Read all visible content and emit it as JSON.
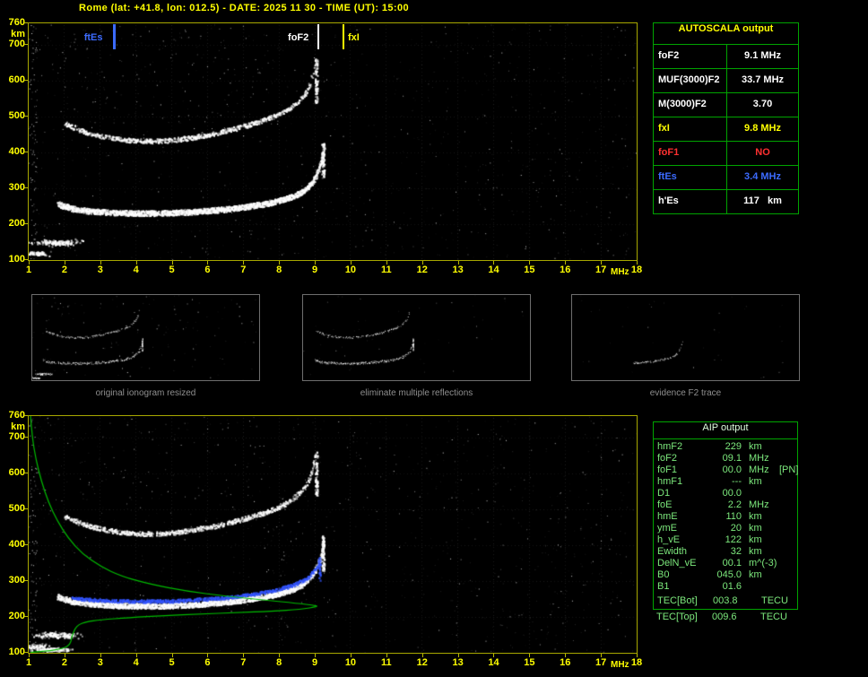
{
  "header": {
    "title": "Rome (lat: +41.8, lon: 012.5) - DATE: 2025 11 30 - TIME (UT): 15:00"
  },
  "colors": {
    "axis": "#ffff00",
    "plot_border": "#a8a800",
    "table_border": "#00a400",
    "aip_text": "#7ce87c",
    "caption": "#8f8f8f",
    "trace": "#ffffff",
    "blue_trace": "#3355ff",
    "profile": "#00bb00",
    "fof1_no": "#ff3030",
    "ftes_blue": "#3c6bff"
  },
  "axes": {
    "y_ticks": [
      760,
      700,
      600,
      500,
      400,
      300,
      200,
      100
    ],
    "y_unit": "km",
    "x_ticks": [
      1,
      2,
      3,
      4,
      5,
      6,
      7,
      8,
      9,
      10,
      11,
      12,
      13,
      14,
      15,
      16,
      17,
      18
    ],
    "x_unit": "MHz"
  },
  "top_markers": [
    {
      "label": "ftEs",
      "freq": 3.4,
      "color": "#3c6bff",
      "side": "left",
      "w": 3
    },
    {
      "label": "foF2",
      "freq": 9.1,
      "color": "#ffffff",
      "side": "left",
      "w": 2
    },
    {
      "label": "fxI",
      "freq": 9.8,
      "color": "#ffff00",
      "side": "right",
      "w": 2
    }
  ],
  "autoscala": {
    "title": "AUTOSCALA output",
    "rows": [
      {
        "label": "foF2",
        "value": "9.1 MHz",
        "color": "#ffffff"
      },
      {
        "label": "MUF(3000)F2",
        "value": "33.7 MHz",
        "color": "#ffffff"
      },
      {
        "label": "M(3000)F2",
        "value": "3.70",
        "color": "#ffffff"
      },
      {
        "label": "fxI",
        "value": "9.8 MHz",
        "color": "#ffff00"
      },
      {
        "label": "foF1",
        "value": "NO",
        "color": "#ff3030"
      },
      {
        "label": "ftEs",
        "value": "3.4 MHz",
        "color": "#3c6bff"
      },
      {
        "label": "h'Es",
        "value": "117   km",
        "color": "#ffffff"
      }
    ]
  },
  "thumbnails": [
    {
      "caption": "original ionogram resized"
    },
    {
      "caption": "eliminate multiple reflections"
    },
    {
      "caption": "evidence F2 trace"
    }
  ],
  "aip": {
    "title": "AIP output",
    "rows": [
      {
        "label": "hmF2",
        "value": "229",
        "unit": "km",
        "note": ""
      },
      {
        "label": "foF2",
        "value": "09.1",
        "unit": "MHz",
        "note": ""
      },
      {
        "label": "foF1",
        "value": "00.0",
        "unit": "MHz",
        "note": "[PN]"
      },
      {
        "label": "hmF1",
        "value": "---",
        "unit": "km",
        "note": ""
      },
      {
        "label": "D1",
        "value": "00.0",
        "unit": "",
        "note": ""
      },
      {
        "label": "foE",
        "value": "2.2",
        "unit": "MHz",
        "note": ""
      },
      {
        "label": "hmE",
        "value": "110",
        "unit": "km",
        "note": ""
      },
      {
        "label": "ymE",
        "value": "20",
        "unit": "km",
        "note": ""
      },
      {
        "label": "h_vE",
        "value": "122",
        "unit": "km",
        "note": ""
      },
      {
        "label": "Ewidth",
        "value": "32",
        "unit": "km",
        "note": ""
      },
      {
        "label": "DelN_vE",
        "value": "00.1",
        "unit": "m^(-3)",
        "note": ""
      },
      {
        "label": "B0",
        "value": "045.0",
        "unit": "km",
        "note": ""
      },
      {
        "label": "B1",
        "value": "01.6",
        "unit": "",
        "note": ""
      }
    ],
    "tec": [
      {
        "label": "TEC[Bot]",
        "value": "003.8",
        "unit": "TECU"
      },
      {
        "label": "TEC[Top]",
        "value": "009.6",
        "unit": "TECU"
      }
    ]
  },
  "ionogram": {
    "freq_range": [
      1,
      18
    ],
    "height_range_km": [
      100,
      760
    ],
    "hop1": [
      [
        1.8,
        258
      ],
      [
        2.2,
        245
      ],
      [
        2.6,
        239
      ],
      [
        3,
        236
      ],
      [
        3.5,
        233
      ],
      [
        4,
        232
      ],
      [
        4.5,
        232
      ],
      [
        5,
        233
      ],
      [
        5.5,
        235
      ],
      [
        6,
        239
      ],
      [
        6.5,
        243
      ],
      [
        7,
        249
      ],
      [
        7.4,
        255
      ],
      [
        7.8,
        262
      ],
      [
        8.1,
        270
      ],
      [
        8.4,
        280
      ],
      [
        8.6,
        290
      ],
      [
        8.8,
        305
      ],
      [
        8.95,
        322
      ],
      [
        9.05,
        342
      ],
      [
        9.15,
        368
      ],
      [
        9.21,
        395
      ],
      [
        9.25,
        422
      ]
    ],
    "hop2": [
      [
        2.0,
        482
      ],
      [
        2.4,
        464
      ],
      [
        2.8,
        452
      ],
      [
        3.2,
        443
      ],
      [
        3.6,
        437
      ],
      [
        4,
        434
      ],
      [
        4.4,
        433
      ],
      [
        4.8,
        434
      ],
      [
        5.2,
        438
      ],
      [
        5.6,
        444
      ],
      [
        6,
        451
      ],
      [
        6.4,
        459
      ],
      [
        6.8,
        469
      ],
      [
        7.2,
        480
      ],
      [
        7.6,
        493
      ],
      [
        8,
        509
      ],
      [
        8.3,
        525
      ],
      [
        8.55,
        545
      ],
      [
        8.75,
        570
      ],
      [
        8.88,
        600
      ],
      [
        8.97,
        635
      ],
      [
        9.02,
        660
      ]
    ],
    "blue": [
      [
        2.2,
        254
      ],
      [
        2.8,
        249
      ],
      [
        3.5,
        246
      ],
      [
        4.2,
        245
      ],
      [
        5,
        246
      ],
      [
        5.8,
        250
      ],
      [
        6.6,
        256
      ],
      [
        7.3,
        265
      ],
      [
        7.9,
        276
      ],
      [
        8.4,
        291
      ],
      [
        8.75,
        308
      ],
      [
        8.95,
        327
      ],
      [
        9.07,
        348
      ],
      [
        9.12,
        366
      ]
    ],
    "profile": [
      [
        1.05,
        760
      ],
      [
        1.1,
        700
      ],
      [
        1.2,
        640
      ],
      [
        1.35,
        580
      ],
      [
        1.55,
        520
      ],
      [
        1.8,
        468
      ],
      [
        2.1,
        420
      ],
      [
        2.5,
        376
      ],
      [
        3.0,
        341
      ],
      [
        3.6,
        313
      ],
      [
        4.4,
        291
      ],
      [
        5.4,
        272
      ],
      [
        6.5,
        258
      ],
      [
        7.6,
        247
      ],
      [
        8.5,
        238
      ],
      [
        9.0,
        232
      ],
      [
        9.1,
        229
      ],
      [
        8.6,
        221
      ],
      [
        7.8,
        216
      ],
      [
        6.8,
        212
      ],
      [
        5.8,
        208
      ],
      [
        4.8,
        204
      ],
      [
        3.8,
        198
      ],
      [
        3.0,
        192
      ],
      [
        2.6,
        186
      ],
      [
        2.4,
        179
      ],
      [
        2.3,
        168
      ],
      [
        2.25,
        156
      ],
      [
        2.2,
        143
      ],
      [
        2.18,
        130
      ],
      [
        2.1,
        118
      ],
      [
        1.9,
        111
      ],
      [
        1.6,
        106
      ],
      [
        1.3,
        103
      ],
      [
        1.05,
        101
      ]
    ],
    "es_cluster": {
      "f": 1.8,
      "h": 150,
      "rf": 0.9,
      "rh": 12,
      "n": 150
    },
    "es2": {
      "f": 1.25,
      "h": 119,
      "rf": 0.45,
      "rh": 9,
      "n": 70
    },
    "es3": {
      "f": 1.6,
      "h": 110,
      "rf": 0.7,
      "rh": 7,
      "n": 160
    },
    "streaks": [
      [
        9.22,
        330,
        428
      ],
      [
        9.03,
        540,
        662
      ]
    ],
    "colors": {
      "trace": "#ffffff",
      "blue": "#3355ff",
      "profile": "#00bb00"
    }
  }
}
